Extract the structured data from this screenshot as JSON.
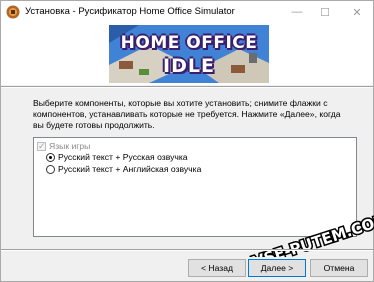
{
  "window": {
    "title": "Установка - Русификатор Home Office Simulator",
    "minimize_glyph": "—",
    "maximize_glyph": "☐",
    "close_glyph": "✕"
  },
  "banner": {
    "logo_line1": "HOME OFFICE",
    "logo_line2": "IDLE"
  },
  "instructions": "Выберите компоненты, которые вы хотите установить; снимите флажки с компонентов, устанавливать которые не требуется. Нажмите «Далее», когда вы будете готовы продолжить.",
  "components": {
    "group": {
      "label": "Язык игры",
      "checked": true,
      "disabled": true
    },
    "options": [
      {
        "label": "Русский текст + Русская озвучка",
        "selected": true
      },
      {
        "label": "Русский текст + Английская озвучка",
        "selected": false
      }
    ]
  },
  "watermark": "VSE-PUTEM.COM",
  "buttons": {
    "back": "< Назад",
    "next": "Далее >",
    "cancel": "Отмена"
  },
  "colors": {
    "accent": "#0078d7",
    "banner_bg": "#2f6fbf",
    "logo_outline": "#3a1f6e"
  }
}
